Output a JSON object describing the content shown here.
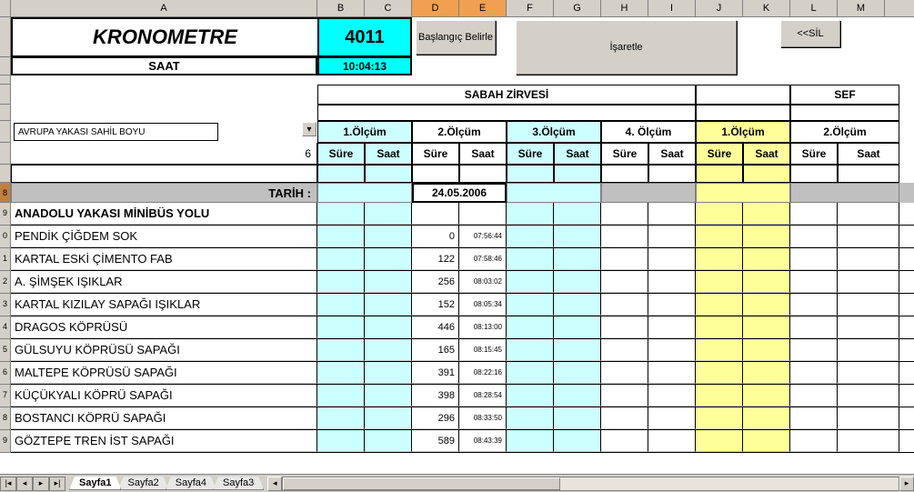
{
  "columns": [
    "A",
    "B",
    "C",
    "D",
    "E",
    "F",
    "G",
    "H",
    "I",
    "J",
    "K",
    "L",
    "M"
  ],
  "selected_cols": [
    "D",
    "E"
  ],
  "header": {
    "title": "KRONOMETRE",
    "counter": "4011",
    "clock_label": "SAAT",
    "clock_value": "10:04:13"
  },
  "buttons": {
    "baslangic": "Başlangıç Belirle",
    "isaretle": "İşaretle",
    "sil": "<<SİL"
  },
  "dropdown": {
    "value": "AVRUPA YAKASI SAHİL BOYU"
  },
  "six_label": "6",
  "zirve": {
    "sabah": "SABAH ZİRVESİ",
    "diger": "SEF"
  },
  "olcum": [
    "1.Ölçüm",
    "2.Ölçüm",
    "3.Ölçüm",
    "4. Ölçüm",
    "1.Ölçüm",
    "2.Ölçüm"
  ],
  "sub": {
    "sure": "Süre",
    "saat": "Saat"
  },
  "tarih": {
    "label": "TARİH  :",
    "value": "24.05.2006"
  },
  "rows": [
    {
      "n": "9",
      "label": "ANADOLU YAKASI MİNİBÜS YOLU",
      "bold": true,
      "sure": "",
      "saat": ""
    },
    {
      "n": "0",
      "label": "PENDİK ÇİĞDEM SOK",
      "sure": "0",
      "saat": "07:56:44"
    },
    {
      "n": "1",
      "label": "KARTAL ESKİ ÇİMENTO FAB",
      "sure": "122",
      "saat": "07:58:46"
    },
    {
      "n": "2",
      "label": "A. ŞİMŞEK IŞIKLAR",
      "sure": "256",
      "saat": "08:03:02"
    },
    {
      "n": "3",
      "label": "KARTAL KIZILAY SAPAĞI IŞIKLAR",
      "sure": "152",
      "saat": "08:05:34"
    },
    {
      "n": "4",
      "label": "DRAGOS KÖPRÜSÜ",
      "sure": "446",
      "saat": "08:13:00"
    },
    {
      "n": "5",
      "label": "GÜLSUYU KÖPRÜSÜ SAPAĞI",
      "sure": "165",
      "saat": "08:15:45"
    },
    {
      "n": "6",
      "label": "MALTEPE KÖPRÜSÜ SAPAĞI",
      "sure": "391",
      "saat": "08:22:16"
    },
    {
      "n": "7",
      "label": "KÜÇÜKYALI KÖPRÜ SAPAĞI",
      "sure": "398",
      "saat": "08:28:54"
    },
    {
      "n": "8",
      "label": "BOSTANCI KÖPRÜ SAPAĞI",
      "sure": "296",
      "saat": "08:33:50"
    },
    {
      "n": "9",
      "label": "GÖZTEPE TREN İST SAPAĞI",
      "sure": "589",
      "saat": "08:43:39"
    }
  ],
  "tabs": [
    "Sayfa1",
    "Sayfa2",
    "Sayfa4",
    "Sayfa3"
  ],
  "active_tab": 0
}
